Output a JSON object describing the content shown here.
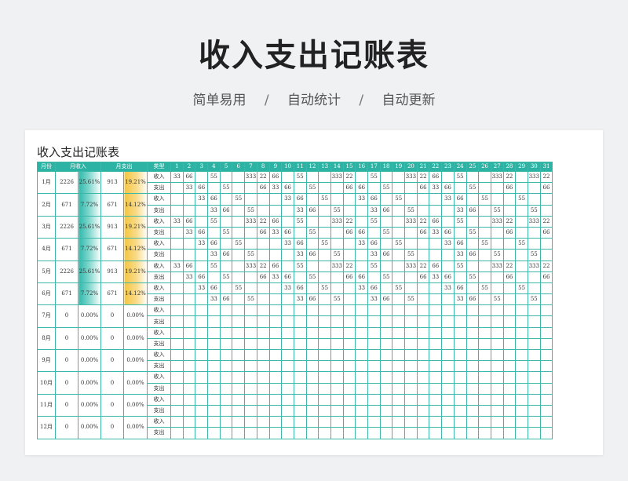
{
  "page": {
    "title": "收入支出记账表",
    "tags": [
      "简单易用",
      "自动统计",
      "自动更新"
    ],
    "separator": "/"
  },
  "sheet": {
    "title": "收入支出记账表",
    "headers": {
      "month": "月份",
      "income": "月收入",
      "expense": "月支出",
      "type": "类型",
      "days": [
        "1",
        "2",
        "3",
        "4",
        "5",
        "6",
        "7",
        "8",
        "9",
        "10",
        "11",
        "12",
        "13",
        "14",
        "15",
        "16",
        "17",
        "18",
        "19",
        "20",
        "21",
        "22",
        "23",
        "24",
        "25",
        "26",
        "27",
        "28",
        "29",
        "30",
        "31"
      ]
    },
    "type_labels": {
      "income": "收入",
      "expense": "支出"
    },
    "colors": {
      "header": "#2db3a4",
      "border": "#3cb8aa",
      "income_bar": "#2fb9aa",
      "expense_bar": "#f5c542"
    },
    "months": [
      {
        "month": "1月",
        "income": "2226",
        "income_pct": "25.61%",
        "expense": "913",
        "expense_pct": "19.21%",
        "in": [
          "33",
          "66",
          "",
          "55",
          "",
          "",
          "333",
          "22",
          "66",
          "",
          "55",
          "",
          "",
          "333",
          "22",
          "",
          "55",
          "",
          "",
          "333",
          "22",
          "66",
          "",
          "55",
          "",
          "",
          "333",
          "22",
          "",
          "333",
          "22"
        ],
        "out": [
          "",
          "33",
          "66",
          "",
          "55",
          "",
          "",
          "66",
          "33",
          "66",
          "",
          "55",
          "",
          "",
          "66",
          "66",
          "",
          "55",
          "",
          "",
          "66",
          "33",
          "66",
          "",
          "55",
          "",
          "",
          "66",
          "",
          "",
          "66"
        ]
      },
      {
        "month": "2月",
        "income": "671",
        "income_pct": "7.72%",
        "expense": "671",
        "expense_pct": "14.12%",
        "in": [
          "",
          "",
          "33",
          "66",
          "",
          "55",
          "",
          "",
          "",
          "33",
          "66",
          "",
          "55",
          "",
          "",
          "33",
          "66",
          "",
          "55",
          "",
          "",
          "",
          "33",
          "66",
          "",
          "55",
          "",
          "",
          "55",
          "",
          ""
        ],
        "out": [
          "",
          "",
          "",
          "33",
          "66",
          "",
          "55",
          "",
          "",
          "",
          "33",
          "66",
          "",
          "55",
          "",
          "",
          "33",
          "66",
          "",
          "55",
          "",
          "",
          "",
          "33",
          "66",
          "",
          "55",
          "",
          "",
          "55",
          ""
        ]
      },
      {
        "month": "3月",
        "income": "2226",
        "income_pct": "25.61%",
        "expense": "913",
        "expense_pct": "19.21%",
        "in": [
          "33",
          "66",
          "",
          "55",
          "",
          "",
          "333",
          "22",
          "66",
          "",
          "55",
          "",
          "",
          "333",
          "22",
          "",
          "55",
          "",
          "",
          "333",
          "22",
          "66",
          "",
          "55",
          "",
          "",
          "333",
          "22",
          "",
          "333",
          "22"
        ],
        "out": [
          "",
          "33",
          "66",
          "",
          "55",
          "",
          "",
          "66",
          "33",
          "66",
          "",
          "55",
          "",
          "",
          "66",
          "66",
          "",
          "55",
          "",
          "",
          "66",
          "33",
          "66",
          "",
          "55",
          "",
          "",
          "66",
          "",
          "",
          "66"
        ]
      },
      {
        "month": "4月",
        "income": "671",
        "income_pct": "7.72%",
        "expense": "671",
        "expense_pct": "14.12%",
        "in": [
          "",
          "",
          "33",
          "66",
          "",
          "55",
          "",
          "",
          "",
          "33",
          "66",
          "",
          "55",
          "",
          "",
          "33",
          "66",
          "",
          "55",
          "",
          "",
          "",
          "33",
          "66",
          "",
          "55",
          "",
          "",
          "55",
          "",
          ""
        ],
        "out": [
          "",
          "",
          "",
          "33",
          "66",
          "",
          "55",
          "",
          "",
          "",
          "33",
          "66",
          "",
          "55",
          "",
          "",
          "33",
          "66",
          "",
          "55",
          "",
          "",
          "",
          "33",
          "66",
          "",
          "55",
          "",
          "",
          "55",
          ""
        ]
      },
      {
        "month": "5月",
        "income": "2226",
        "income_pct": "25.61%",
        "expense": "913",
        "expense_pct": "19.21%",
        "in": [
          "33",
          "66",
          "",
          "55",
          "",
          "",
          "333",
          "22",
          "66",
          "",
          "55",
          "",
          "",
          "333",
          "22",
          "",
          "55",
          "",
          "",
          "333",
          "22",
          "66",
          "",
          "55",
          "",
          "",
          "333",
          "22",
          "",
          "333",
          "22"
        ],
        "out": [
          "",
          "33",
          "66",
          "",
          "55",
          "",
          "",
          "66",
          "33",
          "66",
          "",
          "55",
          "",
          "",
          "66",
          "66",
          "",
          "55",
          "",
          "",
          "66",
          "33",
          "66",
          "",
          "55",
          "",
          "",
          "66",
          "",
          "",
          "66"
        ]
      },
      {
        "month": "6月",
        "income": "671",
        "income_pct": "7.72%",
        "expense": "671",
        "expense_pct": "14.12%",
        "in": [
          "",
          "",
          "33",
          "66",
          "",
          "55",
          "",
          "",
          "",
          "33",
          "66",
          "",
          "55",
          "",
          "",
          "33",
          "66",
          "",
          "55",
          "",
          "",
          "",
          "33",
          "66",
          "",
          "55",
          "",
          "",
          "55",
          "",
          ""
        ],
        "out": [
          "",
          "",
          "",
          "33",
          "66",
          "",
          "55",
          "",
          "",
          "",
          "33",
          "66",
          "",
          "55",
          "",
          "",
          "33",
          "66",
          "",
          "55",
          "",
          "",
          "",
          "33",
          "66",
          "",
          "55",
          "",
          "",
          "55",
          ""
        ]
      },
      {
        "month": "7月",
        "income": "0",
        "income_pct": "0.00%",
        "expense": "0",
        "expense_pct": "0.00%",
        "in": [],
        "out": []
      },
      {
        "month": "8月",
        "income": "0",
        "income_pct": "0.00%",
        "expense": "0",
        "expense_pct": "0.00%",
        "in": [],
        "out": []
      },
      {
        "month": "9月",
        "income": "0",
        "income_pct": "0.00%",
        "expense": "0",
        "expense_pct": "0.00%",
        "in": [],
        "out": []
      },
      {
        "month": "10月",
        "income": "0",
        "income_pct": "0.00%",
        "expense": "0",
        "expense_pct": "0.00%",
        "in": [],
        "out": []
      },
      {
        "month": "11月",
        "income": "0",
        "income_pct": "0.00%",
        "expense": "0",
        "expense_pct": "0.00%",
        "in": [],
        "out": []
      },
      {
        "month": "12月",
        "income": "0",
        "income_pct": "0.00%",
        "expense": "0",
        "expense_pct": "0.00%",
        "in": [],
        "out": []
      }
    ]
  }
}
